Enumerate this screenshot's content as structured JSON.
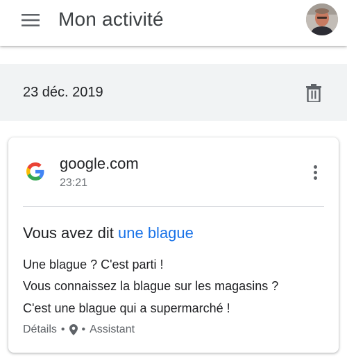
{
  "app_bar": {
    "title": "Mon activité",
    "menu_icon": "hamburger-menu-icon",
    "avatar": "user-avatar-photo"
  },
  "date_group": {
    "date": "23 déc. 2019",
    "delete_icon": "trash-icon"
  },
  "activity": {
    "product_icon": "google-g-logo",
    "site": "google.com",
    "time": "23:21",
    "more_icon": "more-vert-icon",
    "prefix": "Vous avez dit",
    "query": "une blague",
    "reply_lines": [
      "Une blague ? C'est parti !",
      "Vous connaissez la blague sur les magasins ?",
      "C'est une blague qui a supermarché !"
    ],
    "meta": {
      "details": "Détails",
      "separator": "•",
      "location_icon": "location-pin-icon",
      "source": "Assistant"
    }
  },
  "colors": {
    "link_blue": "#1a73e8",
    "date_band": "#f1f3f4",
    "secondary_text": "#70757a"
  }
}
